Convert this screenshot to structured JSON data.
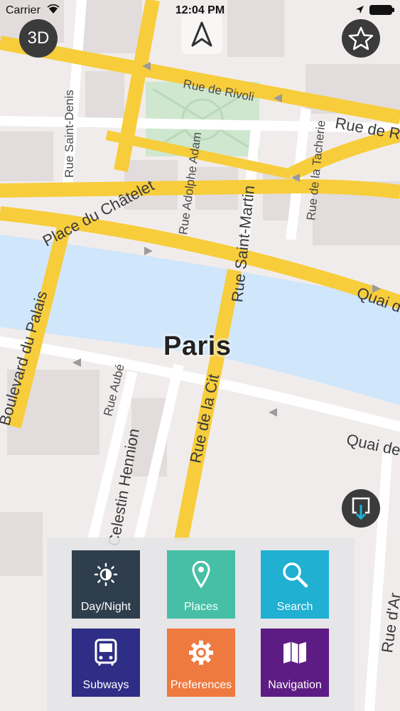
{
  "status_bar": {
    "carrier": "Carrier",
    "time": "12:04 PM"
  },
  "controls": {
    "view_3d_label": "3D"
  },
  "map": {
    "city_label": "Paris",
    "streets": {
      "rue_de_rivoli": "Rue de Rivoli",
      "rue_de_r": "Rue de R",
      "rue_saint_denis": "Rue Saint-Denis",
      "rue_adolphe_adam": "Rue Adolphe Adam",
      "rue_de_la_tacherie": "Rue de la Tacherie",
      "place_du_chatelet": "Place du Châtelet",
      "rue_saint_martin": "Rue Saint-Martin",
      "quai_right": "Quai d",
      "boulevard_du_palais": "Boulevard du Palais",
      "rue_aube": "Rue Aubé",
      "rue_de_la_cite": "Rue de la Cit",
      "celestin_hennion": "Celestin Hennion",
      "quai_de": "Quai de",
      "rue_d_arcole": "Rue d'Ar"
    }
  },
  "menu": {
    "tiles": [
      {
        "label": "Day/Night",
        "icon": "day-night-icon",
        "color": "#2f3e4c"
      },
      {
        "label": "Places",
        "icon": "map-pin-icon",
        "color": "#46bfa6"
      },
      {
        "label": "Search",
        "icon": "search-icon",
        "color": "#1fb0d2"
      },
      {
        "label": "Subways",
        "icon": "bus-icon",
        "color": "#2e2e86"
      },
      {
        "label": "Preferences",
        "icon": "gear-icon",
        "color": "#ef7a3f"
      },
      {
        "label": "Navigation",
        "icon": "map-icon",
        "color": "#5d1c83"
      }
    ]
  }
}
